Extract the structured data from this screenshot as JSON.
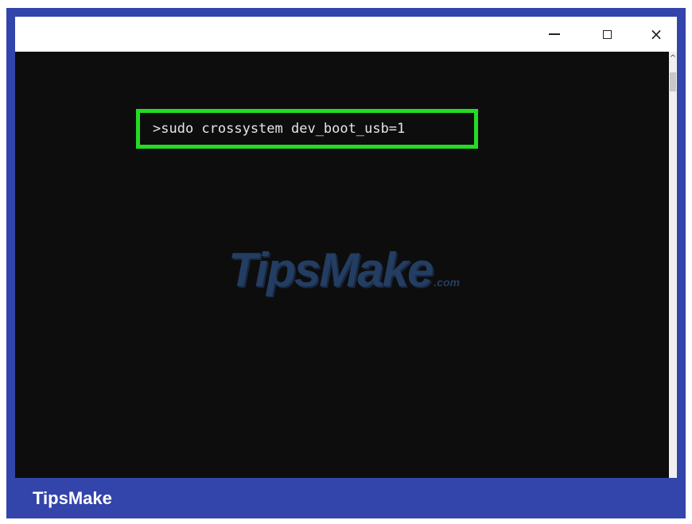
{
  "window": {
    "controls": {
      "minimize_icon": "minimize-icon",
      "maximize_icon": "maximize-icon",
      "close_icon": "close-icon",
      "close_glyph": "×"
    }
  },
  "console": {
    "command": ">sudo crossystem dev_boot_usb=1",
    "highlight_color": "#22dd22",
    "scroll_up_glyph": "^"
  },
  "watermark": {
    "main": "TipsMake",
    "suffix": ".com"
  },
  "footer": {
    "brand": "TipsMake",
    "background_color": "#3344aa"
  }
}
